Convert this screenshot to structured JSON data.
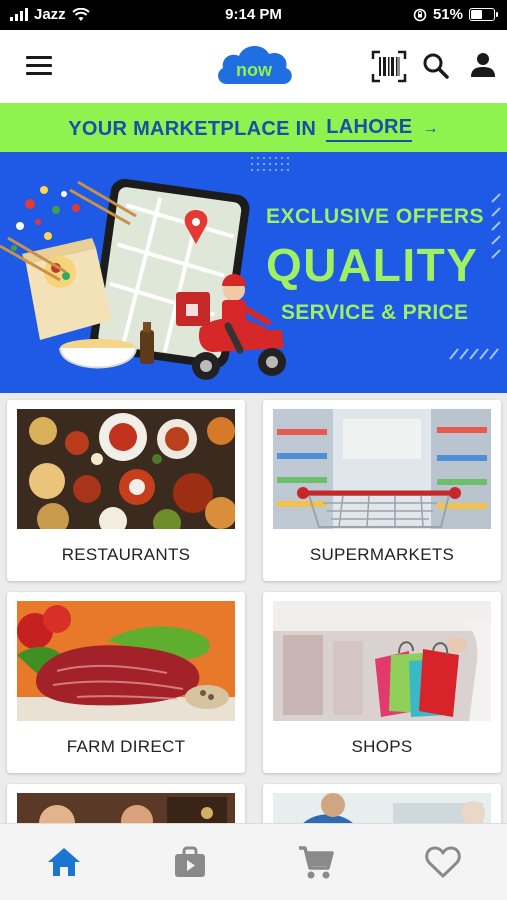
{
  "status_bar": {
    "carrier": "Jazz",
    "time": "9:14 PM",
    "battery_percent": "51%",
    "battery_level": 0.51
  },
  "header": {
    "logo_text": "now",
    "icons": [
      "menu-icon",
      "barcode-icon",
      "search-icon",
      "user-icon"
    ]
  },
  "marketplace": {
    "prefix": "YOUR MARKETPLACE IN",
    "city": "LAHORE",
    "arrow": "→"
  },
  "banner": {
    "line1": "EXCLUSIVE OFFERS",
    "line2": "QUALITY",
    "line3": "SERVICE & PRICE"
  },
  "categories": [
    {
      "label": "RESTAURANTS"
    },
    {
      "label": "SUPERMARKETS"
    },
    {
      "label": "FARM DIRECT"
    },
    {
      "label": "SHOPS"
    }
  ],
  "bottom_nav": {
    "items": [
      "home-icon",
      "store-bag-icon",
      "cart-icon",
      "heart-icon"
    ],
    "active": "home-icon"
  },
  "colors": {
    "brand_blue": "#1e5ae6",
    "accent_green": "#8ef24f",
    "nav_active": "#1976d2",
    "nav_inactive": "#8a8a8a"
  }
}
